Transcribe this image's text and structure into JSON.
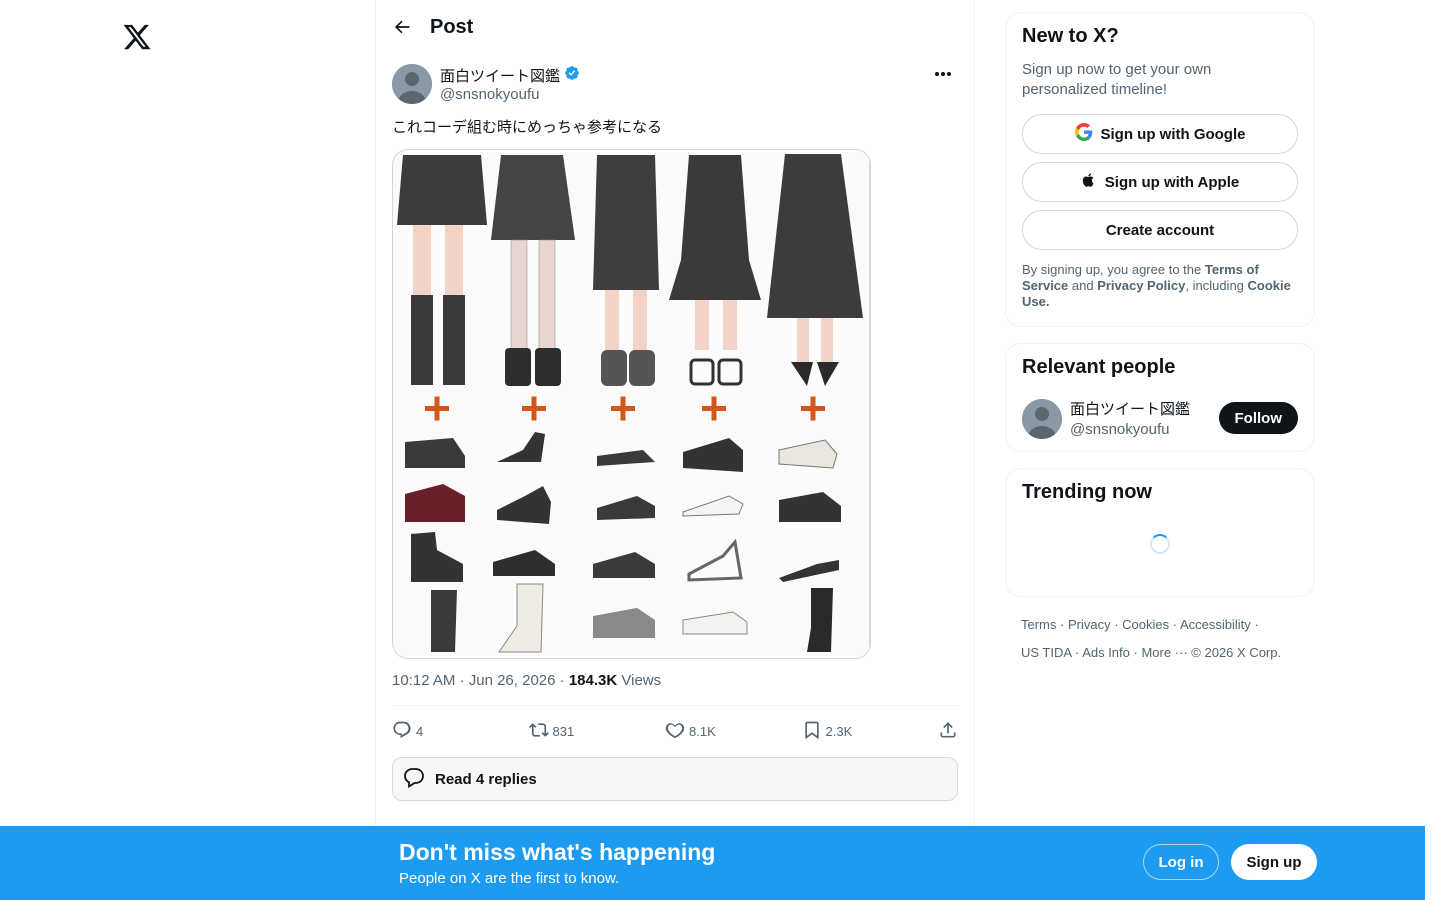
{
  "header": {
    "title": "Post"
  },
  "post": {
    "display_name": "面白ツイート図鑑",
    "handle": "@snsnokyoufu",
    "text": "これコーデ組む時にめっちゃ参考になる",
    "time": "10:12 AM",
    "date": "Jun 26, 2026",
    "views_count": "184.3K",
    "views_label": "Views",
    "replies": "4",
    "reposts": "831",
    "likes": "8.1K",
    "bookmarks": "2.3K",
    "read_replies": "Read 4 replies"
  },
  "sidebar": {
    "signup_card": {
      "title": "New to X?",
      "subtitle": "Sign up now to get your own personalized timeline!",
      "google": "Sign up with Google",
      "apple": "Sign up with Apple",
      "create": "Create account",
      "legal_1": "By signing up, you agree to the ",
      "terms": "Terms of Service",
      "legal_2": " and ",
      "privacy": "Privacy Policy",
      "legal_3": ", including ",
      "cookie": "Cookie Use.",
      "legal_4": ""
    },
    "relevant": {
      "title": "Relevant people",
      "name": "面白ツイート図鑑",
      "handle": "@snsnokyoufu",
      "follow": "Follow"
    },
    "trending": {
      "title": "Trending now"
    },
    "footer": [
      "Terms",
      "Privacy",
      "Cookies",
      "Accessibility",
      "US TIDA",
      "Ads Info",
      "More ···",
      "© 2026 X Corp."
    ]
  },
  "banner": {
    "title": "Don't miss what's happening",
    "subtitle": "People on X are the first to know.",
    "login": "Log in",
    "signup": "Sign up"
  },
  "colors": {
    "accent": "#1d9bf0",
    "text": "#0f1419",
    "muted": "#536471",
    "plus": "#d4561a"
  }
}
